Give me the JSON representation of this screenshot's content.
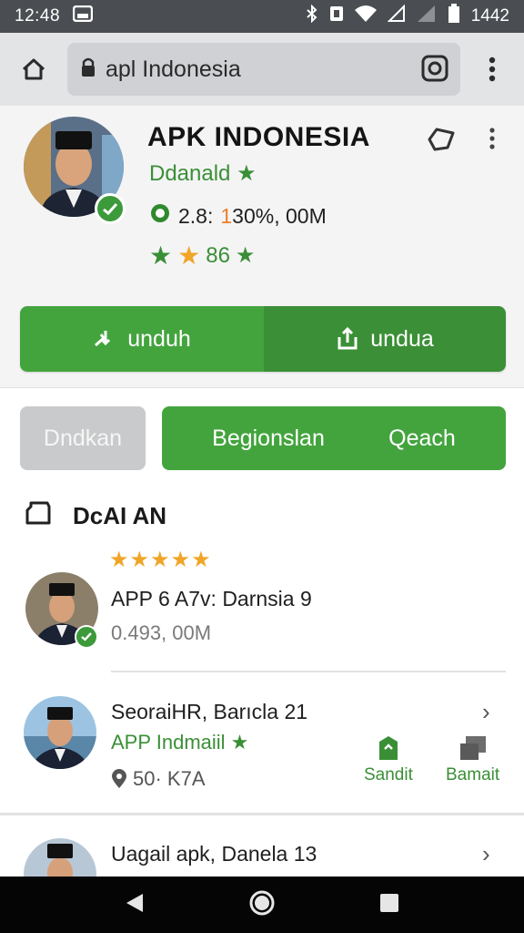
{
  "status_bar": {
    "time": "12:48",
    "battery_time": "1442"
  },
  "browser": {
    "url": "apl Indonesia"
  },
  "app": {
    "title": "APK INDONESIA",
    "developer": "Ddanald",
    "stats_prefix": "2.8:",
    "stats_highlight": "1",
    "stats_suffix": "30%, 00M",
    "rating_label": "86"
  },
  "download": {
    "left_label": "unduh",
    "right_label": "undua"
  },
  "tabs": {
    "gray_label": "Dndkan",
    "green_left": "Begionslan",
    "green_right": "Qeach"
  },
  "section": {
    "title": "DcAI AN"
  },
  "list": [
    {
      "title": "APP 6 A7v: Darnsia 9",
      "subtitle": "0.493, 00M",
      "stars": "★★★★★"
    },
    {
      "title": "SeoraiHR, Barıcla 21",
      "developer": "APP Indmaiil",
      "meta": "50· K7A",
      "action1": "Sandit",
      "action2": "Bamait"
    },
    {
      "title": "Uagail apk, Danela 13"
    }
  ],
  "colors": {
    "green": "#43a43e",
    "dark_green": "#3b8f36",
    "accent_orange": "#e8802a"
  }
}
